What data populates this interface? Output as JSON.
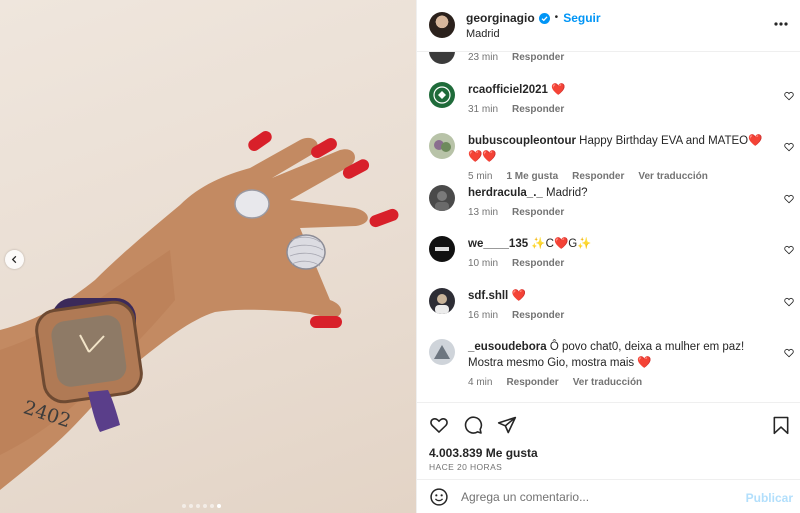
{
  "header": {
    "username": "georginagio",
    "separator": "•",
    "follow_label": "Seguir",
    "location": "Madrid"
  },
  "media": {
    "tattoo_text": "2402",
    "carousel": {
      "count": 6,
      "active_index": 5
    }
  },
  "comments": [
    {
      "user": "",
      "text": "",
      "time": "23 min",
      "likes": "",
      "reply": "Responder",
      "translate": ""
    },
    {
      "user": "rcaofficiel2021",
      "text": "❤️",
      "time": "31 min",
      "likes": "",
      "reply": "Responder",
      "translate": ""
    },
    {
      "user": "bubuscoupleontour",
      "text": "Happy Birthday EVA and MATEO❤️❤️❤️",
      "time": "5 min",
      "likes": "1 Me gusta",
      "reply": "Responder",
      "translate": "Ver traducción"
    },
    {
      "user": "herdracula_._",
      "text": "Madrid?",
      "time": "13 min",
      "likes": "",
      "reply": "Responder",
      "translate": ""
    },
    {
      "user": "we____135",
      "text": "✨C❤️G✨",
      "time": "10 min",
      "likes": "",
      "reply": "Responder",
      "translate": ""
    },
    {
      "user": "sdf.shll",
      "text": "❤️",
      "time": "16 min",
      "likes": "",
      "reply": "Responder",
      "translate": ""
    },
    {
      "user": "_eusoudebora",
      "text": "Ô povo chat0, deixa a mulher em paz! Mostra mesmo Gio, mostra mais ❤️",
      "time": "4 min",
      "likes": "",
      "reply": "Responder",
      "translate": "Ver traducción"
    }
  ],
  "footer": {
    "likes": "4.003.839 Me gusta",
    "time": "Hace 20 horas",
    "comment_placeholder": "Agrega un comentario...",
    "publish_label": "Publicar"
  },
  "colors": {
    "accent": "#0095f6",
    "publish_disabled": "#b2dffc",
    "text": "#262626",
    "muted": "#737373",
    "nail_red": "#d8202a"
  }
}
